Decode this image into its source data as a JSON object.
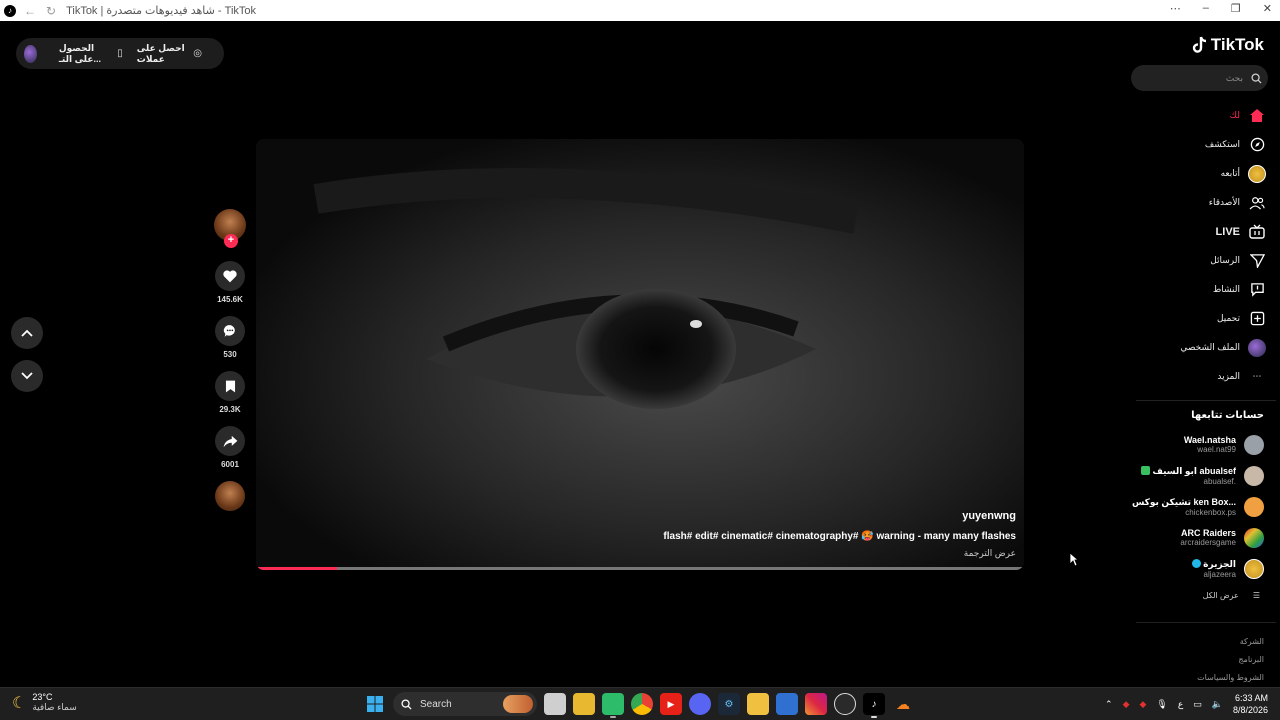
{
  "window": {
    "title": "TikTok | شاهد فيديوهات متصدرة - TikTok"
  },
  "top_pill": {
    "get_coins": "احصل على عملات",
    "get_app": "الحصول على التـ..."
  },
  "video": {
    "author": "yuyenwng",
    "caption": "flash# edit# cinematic# cinematography# 🥵 warning - many many flashes",
    "translate": "عرض الترجمة",
    "progress_fraction": 0.105
  },
  "actions": {
    "likes": "145.6K",
    "comments": "530",
    "saves": "29.3K",
    "shares": "6001",
    "follow_icon": "plus-icon"
  },
  "sidebar": {
    "logo": "TikTok",
    "search_placeholder": "بحث",
    "menu": [
      {
        "label": "لك",
        "icon": "home-icon",
        "active": true
      },
      {
        "label": "استكشف",
        "icon": "compass-icon"
      },
      {
        "label": "أتابعه",
        "icon": "following-avatar-icon"
      },
      {
        "label": "الأصدقاء",
        "icon": "friends-icon"
      },
      {
        "label": "LIVE",
        "icon": "live-icon"
      },
      {
        "label": "الرسائل",
        "icon": "send-icon"
      },
      {
        "label": "النشاط",
        "icon": "activity-icon"
      },
      {
        "label": "تحميل",
        "icon": "upload-icon"
      },
      {
        "label": "الملف الشخصي",
        "icon": "profile-avatar-icon"
      },
      {
        "label": "المزيد",
        "icon": "more-icon"
      }
    ],
    "following_title": "حسابات تتابعها",
    "following": [
      {
        "name": "Wael.natsha",
        "handle": "wael.nat99",
        "color": "#9aa0a8"
      },
      {
        "name": "ابو السيف abualsef",
        "handle": "abualsef.",
        "color": "#c8b8a8"
      },
      {
        "name": "تشيكن بوكس ken Box...",
        "handle": "chickenbox.ps",
        "color": "#f0a040"
      },
      {
        "name": "ARC Raiders",
        "handle": "arcraidersgame",
        "color": "#303030"
      },
      {
        "name": "الجزيرة",
        "handle": "aljazeera",
        "color": "#e8b020"
      }
    ],
    "see_all": "عرض الكل",
    "footer": [
      "الشركة",
      "البرنامج",
      "الشروط والسياسات"
    ]
  },
  "taskbar": {
    "temp": "23°C",
    "weather_desc": "سماء صافية",
    "search": "Search",
    "time": "6:33 AM",
    "date": "8/8/2026",
    "lang": "ع",
    "apps": [
      "file-explorer-icon",
      "store-icon",
      "whatsapp-icon",
      "chrome-icon",
      "youtube-icon",
      "discord-icon",
      "steam-icon",
      "folder-icon",
      "media-icon",
      "instagram-icon",
      "settings-icon",
      "tiktok-icon",
      "cloud-icon"
    ]
  },
  "colors": {
    "accent": "#fe2c55",
    "background": "#000000",
    "taskbar": "#1f1f1f"
  }
}
